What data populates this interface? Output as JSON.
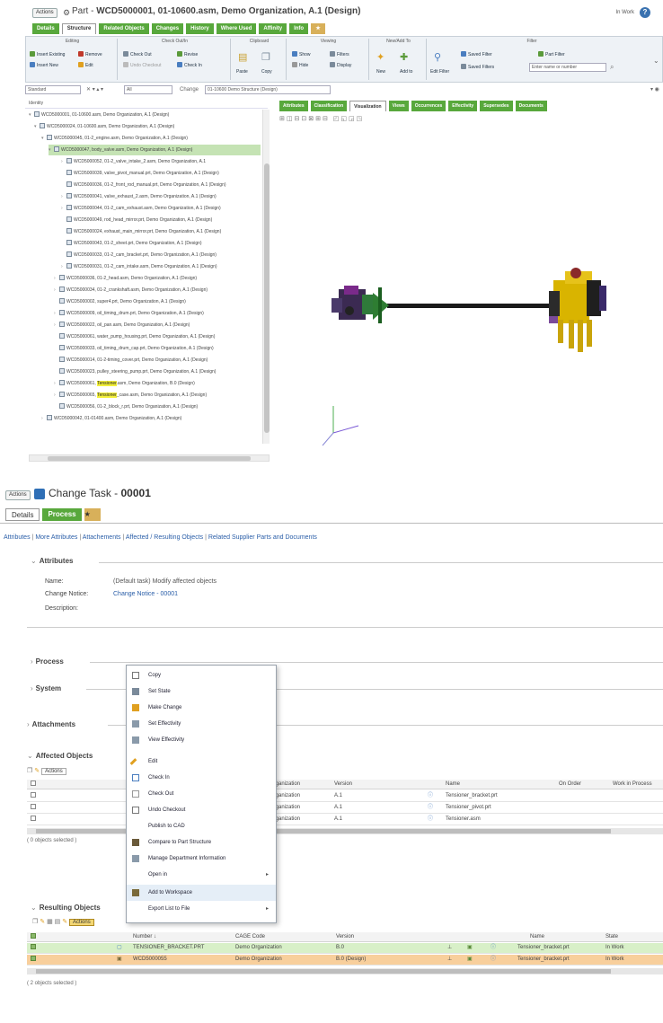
{
  "top": {
    "actions_label": "Actions",
    "title_kind": "Part -",
    "title": "WCD5000001, 01-10600.asm, Demo Organization, A.1 (Design)",
    "status": "In Work",
    "help": "?",
    "tabs": [
      "Details",
      "Structure",
      "Related Objects",
      "Changes",
      "History",
      "Where Used",
      "Affinity",
      "Info",
      "★"
    ],
    "ribbon": {
      "groups": [
        {
          "title": "Editing",
          "items": [
            "Insert Existing",
            "Remove",
            "Insert New",
            "Edit"
          ]
        },
        {
          "title": "Check Out/In",
          "items": [
            "Check Out",
            "Revise",
            "Undo Checkout",
            "Check In"
          ]
        },
        {
          "title": "Clipboard",
          "items": [
            "Paste",
            "Copy"
          ]
        },
        {
          "title": "Viewing",
          "items": [
            "Show",
            "Filters",
            "Hide",
            "Display"
          ]
        },
        {
          "title": "New/Add To",
          "items": [
            "New",
            "Add to"
          ]
        },
        {
          "title": "Filter",
          "items": [
            "Edit Filter",
            "Saved Filter",
            "Part Filter",
            "Saved Filters"
          ]
        }
      ],
      "filter_placeholder": "Enter name or number"
    },
    "search": {
      "value": "Standard",
      "view": "All",
      "change_label": "Change",
      "path": "01-10600 Demo Structure (Design)"
    },
    "tree_header": "Identity",
    "tree": [
      {
        "text": "WCD5000001, 01-10600.asm, Demo Organization, A.1 (Design)"
      },
      {
        "text": "WCD5000024, 01-10600.asm, Demo Organization, A.1 (Design)"
      },
      {
        "text": "WCD5000045, 01-2_engine.asm, Demo Organization, A.1 (Design)"
      },
      {
        "text": "WCD5000047, body_valve.asm, Demo Organization, A.1 (Design)"
      },
      {
        "text": "WCD5000052, 01-2_valve_intake_2.asm, Demo Organization, A.1"
      },
      {
        "text": "WCD5000039, valve_pivot_manual.prt, Demo Organization, A.1 (Design)"
      },
      {
        "text": "WCD5000036, 01-2_front_rod_manual.prt, Demo Organization, A.1 (Design)"
      },
      {
        "text": "WCD5000041, valve_exhaust_2.asm, Demo Organization, A.1 (Design)"
      },
      {
        "text": "WCD5000044, 01-2_cam_exhaust.asm, Demo Organization, A.1 (Design)"
      },
      {
        "text": "WCD5000049, rod_head_mirror.prt, Demo Organization, A.1 (Design)"
      },
      {
        "text": "WCD5000024, exhaust_main_mirror.prt, Demo Organization, A.1 (Design)"
      },
      {
        "text": "WCD5000043, 01-2_sheet.prt, Demo Organization, A.1 (Design)"
      },
      {
        "text": "WCD5000033, 01-2_cam_bracket.prt, Demo Organization, A.1 (Design)"
      },
      {
        "text": "WCD5000031, 01-2_cam_intake.asm, Demo Organization, A.1 (Design)"
      },
      {
        "text": "WCD5000036, 01-2_head.asm, Demo Organization, A.1 (Design)"
      },
      {
        "text": "WCD5000034, 01-2_crankshaft.asm, Demo Organization, A.1 (Design)"
      },
      {
        "text": "WCD5000002, super4.prt, Demo Organization, A.1 (Design)"
      },
      {
        "text": "WCD5000009, oil_timing_drum.prt, Demo Organization, A.1 (Design)"
      },
      {
        "text": "WCD5000022, oil_pan.asm, Demo Organization, A.1 (Design)"
      },
      {
        "text": "WCD5000061, water_pump_housing.prt, Demo Organization, A.1 (Design)"
      },
      {
        "text": "WCD5000033, oil_timing_drum_cap.prt, Demo Organization, A.1 (Design)"
      },
      {
        "text": "WCD5000014, 01-2-timing_cover.prt, Demo Organization, A.1 (Design)"
      },
      {
        "text": "WCD5000023, pulley_steering_pump.prt, Demo Organization, A.1 (Design)"
      },
      {
        "prefix": "WCD5000061, ",
        "highlight": "Tensioner",
        "suffix": ".asm, Demo Organization, B.0 (Design)"
      },
      {
        "prefix": "WCD5000065, ",
        "highlight": "Tensioner",
        "suffix": "_case.asm, Demo Organization, A.1 (Design)"
      },
      {
        "text": "WCD5000056, 01-2_block_r.prt, Demo Organization, A.1 (Design)"
      },
      {
        "text": "WCD5000042, 01-01400.asm, Demo Organization, A.1 (Design)"
      }
    ],
    "viewer_tabs": [
      "Attributes",
      "Classification",
      "Visualization",
      "Views",
      "Occurrences",
      "Effectivity",
      "Supersedes",
      "Documents"
    ]
  },
  "bottom": {
    "actions_label": "Actions",
    "title_prefix": "Change Task - ",
    "title_number": "00001",
    "tabs": [
      "Details",
      "Process",
      "★"
    ],
    "links": [
      "Attributes",
      "More Attributes",
      "Attachements",
      "Affected / Resulting Objects",
      "Related Supplier Parts and Documents"
    ],
    "attributes": {
      "section": "Attributes",
      "name_label": "Name:",
      "name_value": "(Default task) Modify affected objects",
      "notice_label": "Change Notice:",
      "notice_value": "Change Notice - 00001",
      "desc_label": "Description:"
    },
    "sections": {
      "process": "Process",
      "system": "System",
      "attachments": "Attachments",
      "affected": "Affected Objects",
      "resulting": "Resulting Objects"
    },
    "affected": {
      "actions": "Actions",
      "headers": [
        "Organization",
        "Version",
        "Name",
        "On Order",
        "Work in Process"
      ],
      "rows": [
        {
          "org": "Organization",
          "ver": "A.1",
          "name": "Tensioner_bracket.prt"
        },
        {
          "org": "Organization",
          "ver": "A.1",
          "name": "Tensioner_pivot.prt"
        },
        {
          "org": "Organization",
          "ver": "A.1",
          "name": "Tensioner.asm"
        }
      ],
      "status": "( 0 objects selected )"
    },
    "resulting": {
      "actions": "Actions",
      "headers": [
        "Number ↓",
        "CAGE Code",
        "Version",
        "Name",
        "State"
      ],
      "rows": [
        {
          "number": "TENSIONER_BRACKET.PRT",
          "cage": "Demo Organization",
          "ver": "B.0",
          "name": "Tensioner_bracket.prt",
          "state": "In Work"
        },
        {
          "number": "WCD5000055",
          "cage": "Demo Organization",
          "ver": "B.0 (Design)",
          "name": "Tensioner_bracket.prt",
          "state": "In Work"
        }
      ],
      "status": "( 2 objects selected )"
    },
    "menu": [
      {
        "label": "Copy",
        "icon": "copy-icon"
      },
      {
        "label": "Set State",
        "icon": "set-state-icon"
      },
      {
        "label": "Make Change",
        "icon": "make-change-icon"
      },
      {
        "label": "Set Effectivity",
        "icon": "effectivity-icon"
      },
      {
        "label": "View Effectivity",
        "icon": "view-effectivity-icon"
      },
      {
        "label": "Edit",
        "icon": "edit-pencil-icon"
      },
      {
        "label": "Check In",
        "icon": "check-in-icon"
      },
      {
        "label": "Check Out",
        "icon": "check-out-icon"
      },
      {
        "label": "Undo Checkout",
        "icon": "undo-checkout-icon"
      },
      {
        "label": "Publish to CAD",
        "icon": ""
      },
      {
        "label": "Compare to Part Structure",
        "icon": "compare-icon"
      },
      {
        "label": "Manage Department Information",
        "icon": "manage-icon"
      },
      {
        "label": "Open in",
        "icon": "",
        "submenu": true
      },
      {
        "label": "Add to Workspace",
        "icon": "add-workspace-icon"
      },
      {
        "label": "Export List to File",
        "icon": "",
        "submenu": true
      }
    ],
    "submenu_arrow": "▸"
  }
}
